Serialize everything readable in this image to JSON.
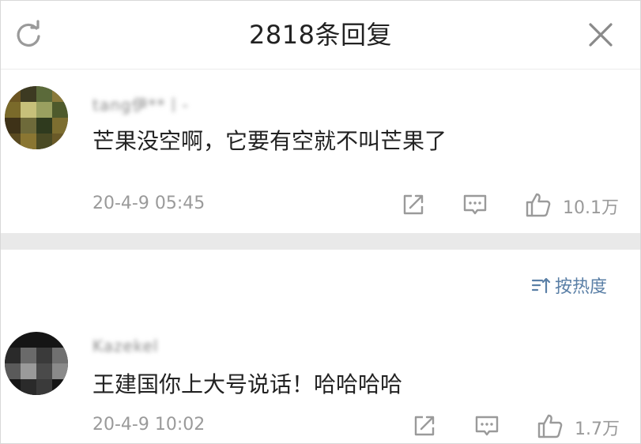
{
  "header": {
    "title": "2818条回复",
    "refresh_icon": "refresh-icon",
    "close_icon": "close-icon"
  },
  "comments": [
    {
      "username": "tang伊**丨-",
      "text": "芒果没空啊，它要有空就不叫芒果了",
      "time": "20-4-9 05:45",
      "likes": "10.1万"
    },
    {
      "username": "Kazekel",
      "text": "王建国你上大号说话！哈哈哈哈",
      "time": "20-4-9 10:02",
      "likes": "1.7万"
    }
  ],
  "sort": {
    "label": "按热度",
    "icon": "sort-icon"
  },
  "colors": {
    "accent": "#5a7fa6",
    "meta_text": "#9a9a9a",
    "divider": "#e9e9e9"
  }
}
